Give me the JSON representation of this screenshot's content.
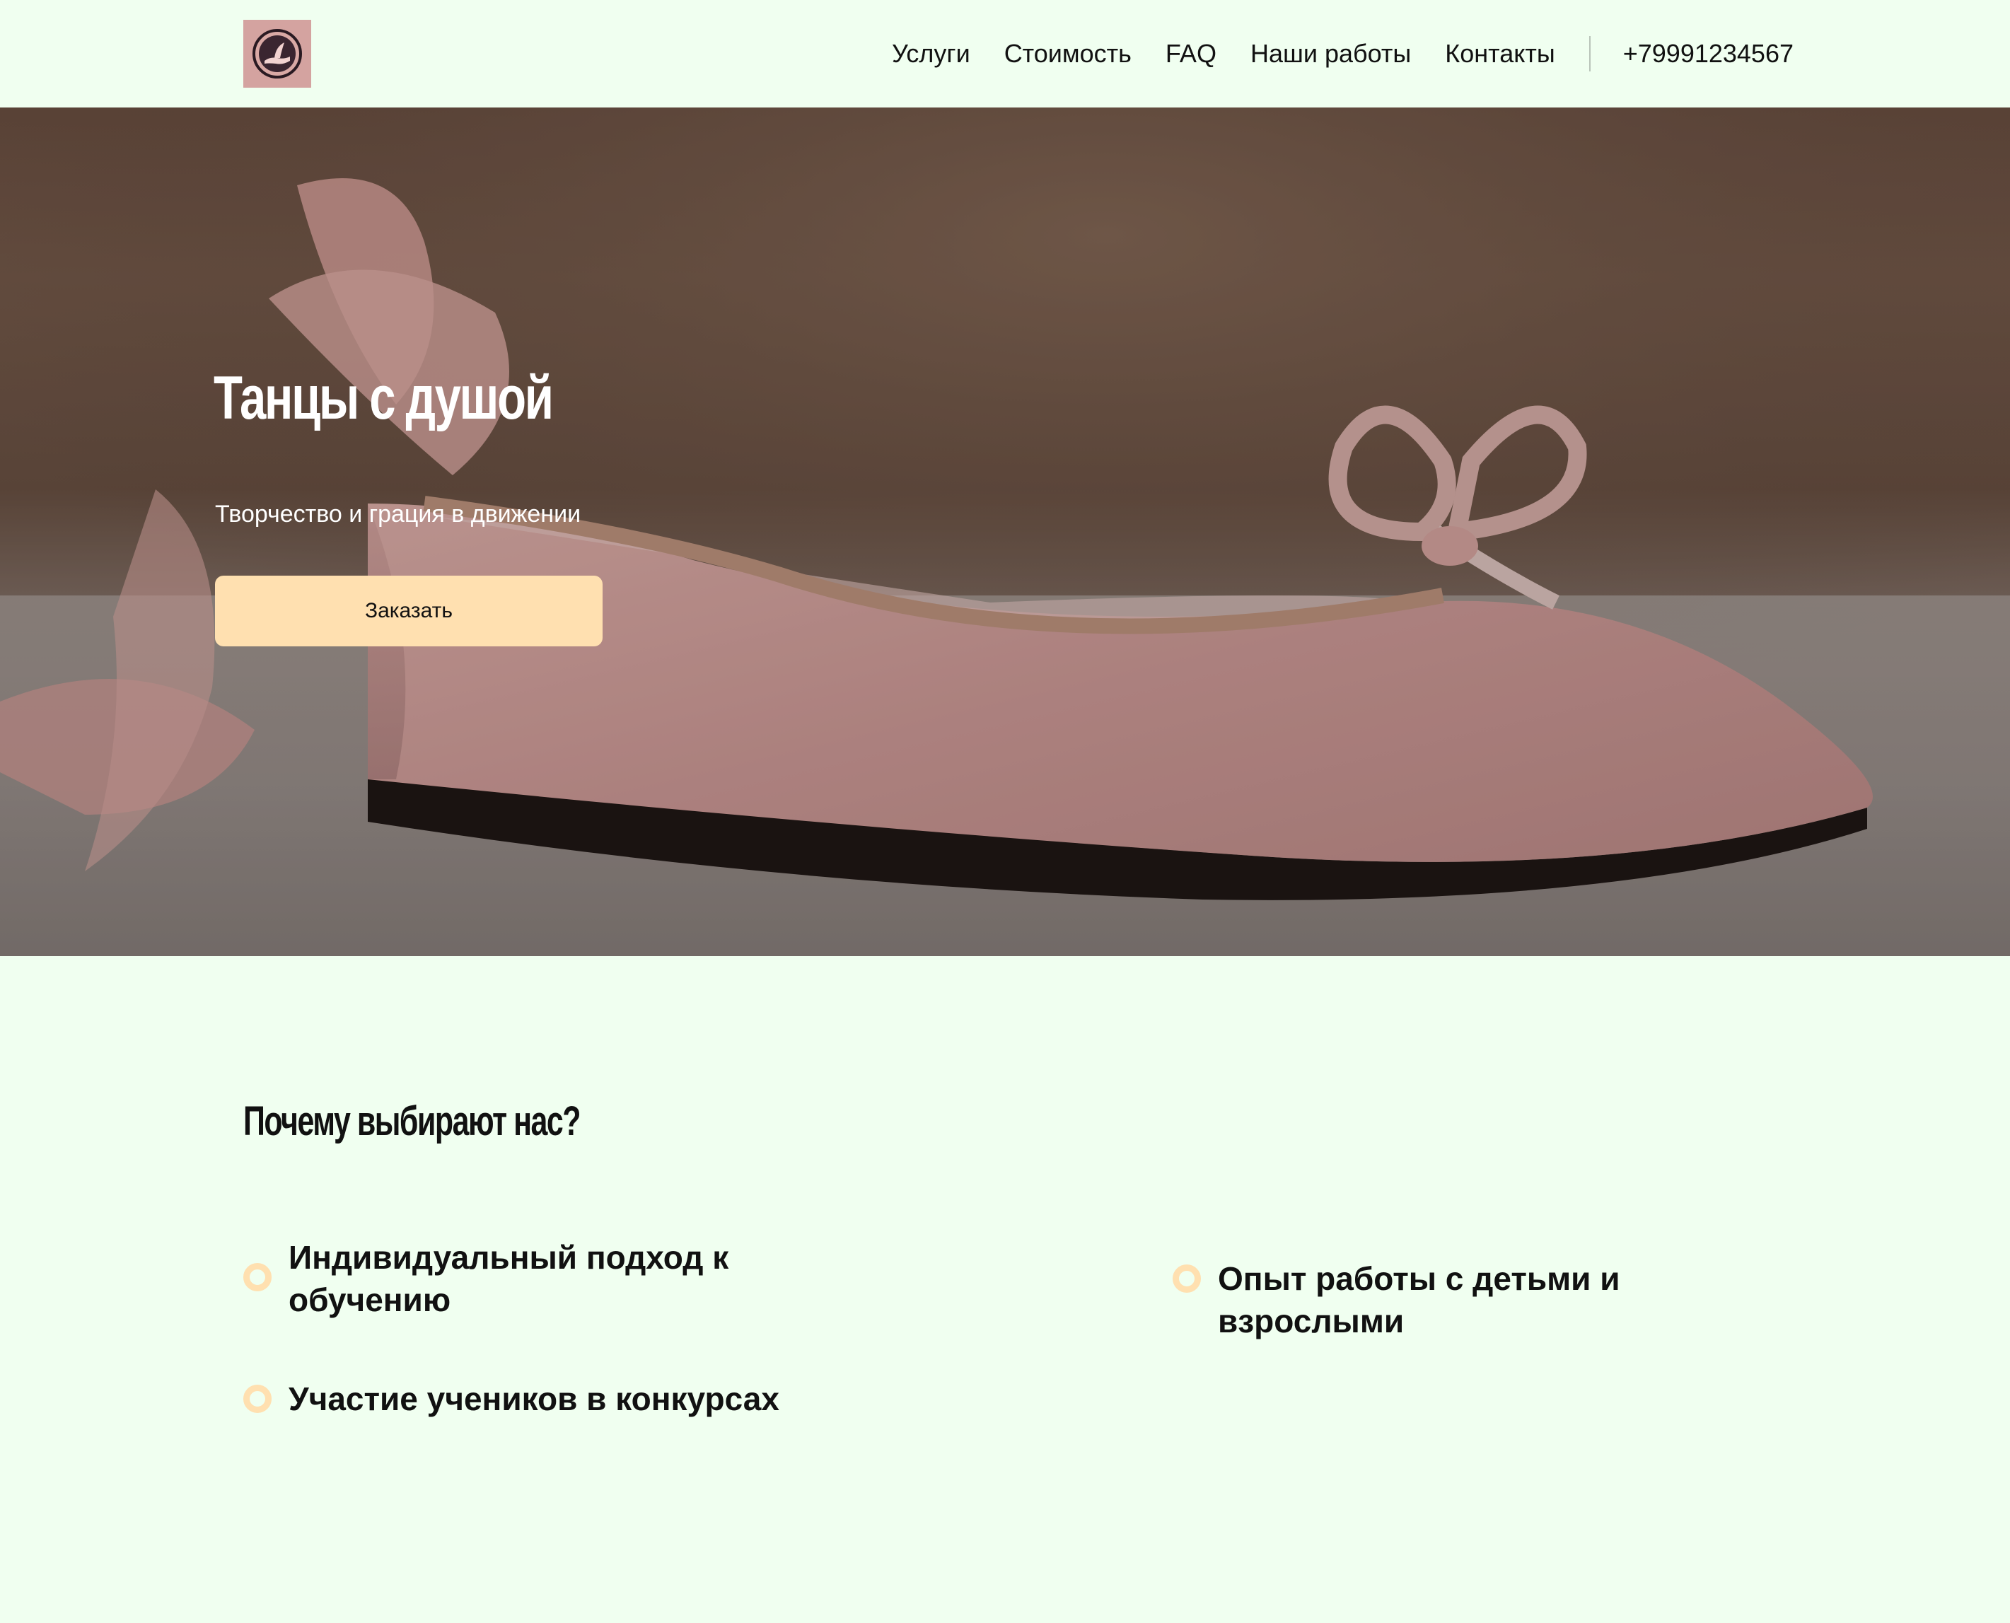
{
  "header": {
    "nav": [
      "Услуги",
      "Стоимость",
      "FAQ",
      "Наши работы",
      "Контакты"
    ],
    "phone": "+79991234567"
  },
  "hero": {
    "title": "Танцы с душой",
    "subtitle": "Творчество и грация в движении",
    "cta_label": "Заказать"
  },
  "features": {
    "title": "Почему выбирают нас?",
    "items": [
      "Индивидуальный подход к обучению",
      "Опыт работы с детьми и взрослыми",
      "Участие учеников в конкурсах"
    ]
  },
  "colors": {
    "background": "#f0fff0",
    "accent": "#ffe0b0",
    "logo_bg": "#d4a3a0"
  }
}
